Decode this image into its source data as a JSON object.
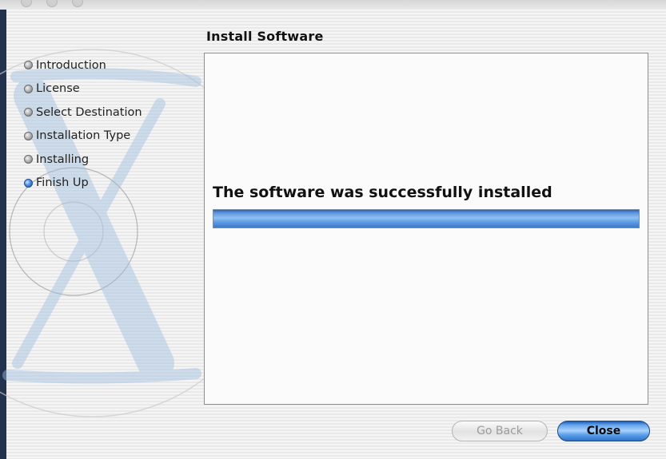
{
  "window": {
    "title": "Install Software"
  },
  "sidebar": {
    "steps": [
      {
        "label": "Introduction",
        "state": "done"
      },
      {
        "label": "License",
        "state": "done"
      },
      {
        "label": "Select Destination",
        "state": "done"
      },
      {
        "label": "Installation Type",
        "state": "done"
      },
      {
        "label": "Installing",
        "state": "done"
      },
      {
        "label": "Finish Up",
        "state": "current"
      }
    ]
  },
  "main": {
    "status_text": "The software was successfully installed",
    "progress_fraction": 1.0
  },
  "buttons": {
    "go_back_label": "Go Back",
    "close_label": "Close"
  },
  "colors": {
    "accent": "#4f8ee0",
    "progress_blue": "#5b91d8",
    "window_edge": "#23324f"
  }
}
